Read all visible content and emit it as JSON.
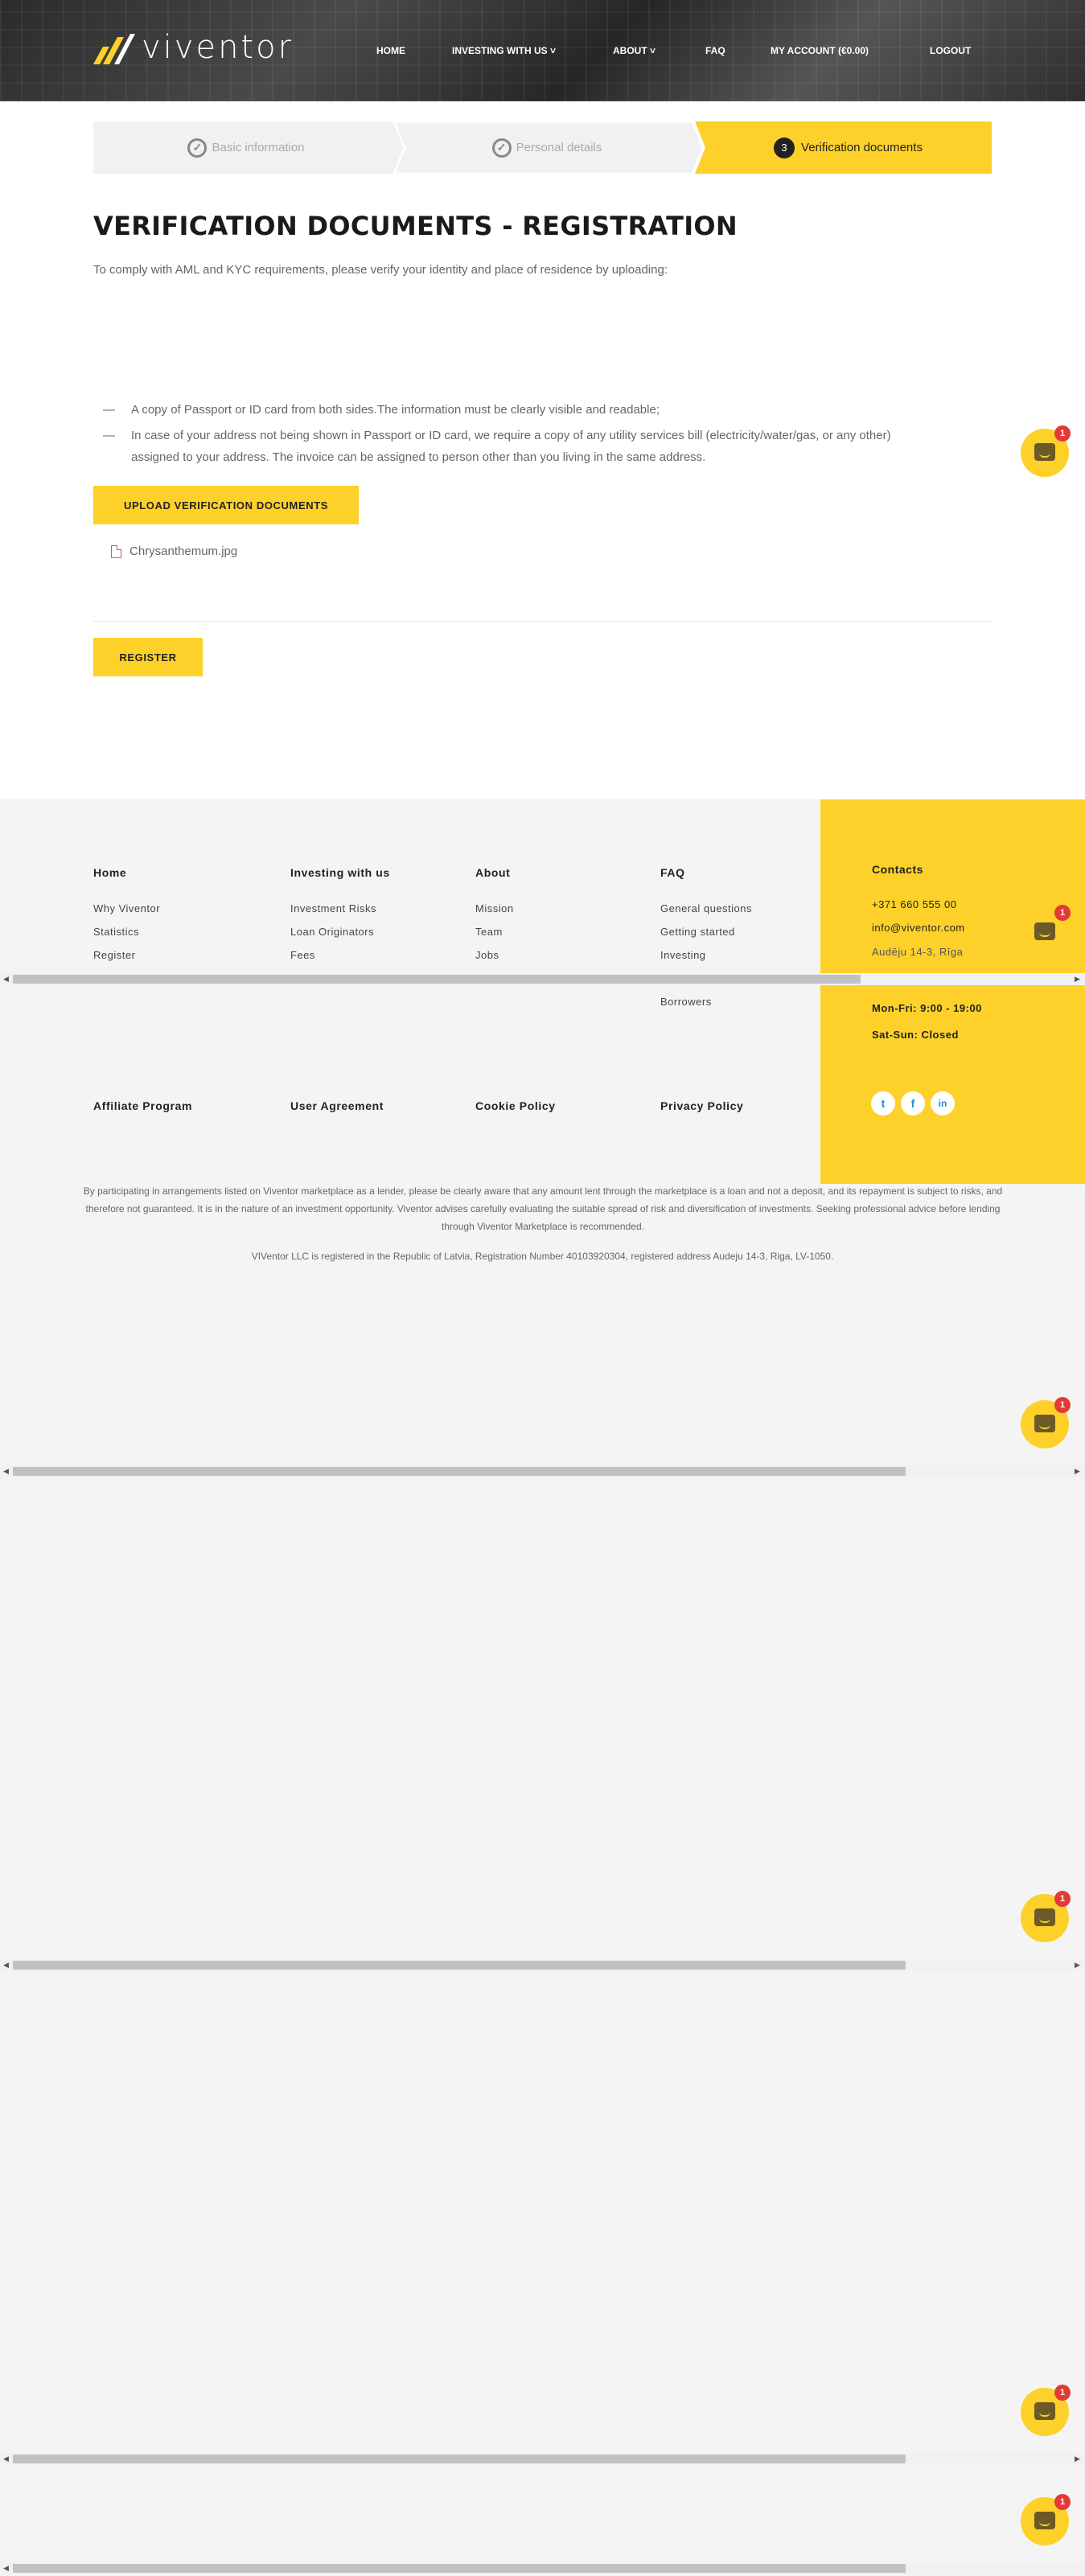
{
  "header": {
    "logo_text": "viventor",
    "nav": [
      {
        "label": "HOME"
      },
      {
        "label": "INVESTING WITH US ˅"
      },
      {
        "label": "ABOUT ˅"
      },
      {
        "label": "FAQ"
      },
      {
        "label": "MY ACCOUNT (€0.00)"
      },
      {
        "label": "LOGOUT"
      }
    ]
  },
  "steps": [
    {
      "label": "Basic information",
      "state": "done"
    },
    {
      "label": "Personal details",
      "state": "done"
    },
    {
      "label": "Verification documents",
      "number": "3",
      "state": "active"
    }
  ],
  "main": {
    "title": "VERIFICATION DOCUMENTS - REGISTRATION",
    "intro": "To comply with AML and KYC requirements, please verify your identity and place of residence by uploading:",
    "requirements": [
      "A copy of Passport or ID card from both sides.The information must be clearly visible and readable;",
      "In case of your address not being shown in Passport or ID card, we require a copy of any utility services bill (electricity/water/gas, or any other)",
      "assigned to your address. The invoice can be assigned to person other than you living in the same address."
    ],
    "dash": "—",
    "upload_label": "UPLOAD VERIFICATION DOCUMENTS",
    "file_name": "Chrysanthemum.jpg",
    "register_label": "REGISTER"
  },
  "footer": {
    "columns": [
      {
        "title": "Home",
        "links": [
          "Why Viventor",
          "Statistics",
          "Register"
        ]
      },
      {
        "title": "Investing with us",
        "links": [
          "Investment Risks",
          "Loan Originators",
          "Fees"
        ]
      },
      {
        "title": "About",
        "links": [
          "Mission",
          "Team",
          "Jobs"
        ]
      },
      {
        "title": "FAQ",
        "links": [
          "General questions",
          "Getting started",
          "Investing",
          "Borrowers"
        ]
      }
    ],
    "bottom_links": [
      "Affiliate Program",
      "User Agreement",
      "Cookie Policy",
      "Privacy Policy"
    ],
    "contacts": {
      "title": "Contacts",
      "phone": "+371 660 555 00",
      "email": "info@viventor.com",
      "address": "Audēju 14-3, Rīga",
      "hours_weekday": "Mon-Fri: 9:00 - 19:00",
      "hours_weekend": "Sat-Sun: Closed"
    },
    "social": [
      "twitter-icon",
      "facebook-icon",
      "linkedin-icon"
    ],
    "social_glyphs": [
      "t",
      "f",
      "in"
    ],
    "disclaimer": "By participating in arrangements listed on Viventor marketplace as a lender, please be clearly aware that any amount lent through the marketplace is a loan and not a deposit, and its repayment is subject to risks, and therefore not guaranteed. It is in the nature of an investment opportunity. Viventor advises carefully evaluating the suitable spread of risk and diversification of investments. Seeking professional advice before lending through Viventor Marketplace is recommended.",
    "registration": "VIVentor LLC is registered in the Republic of Latvia, Registration Number 40103920304, registered address Audeju 14-3, Riga, LV-1050."
  },
  "chat": {
    "badge": "1"
  },
  "colors": {
    "accent": "#fdd12a",
    "dark": "#222222",
    "badge": "#e53935"
  }
}
